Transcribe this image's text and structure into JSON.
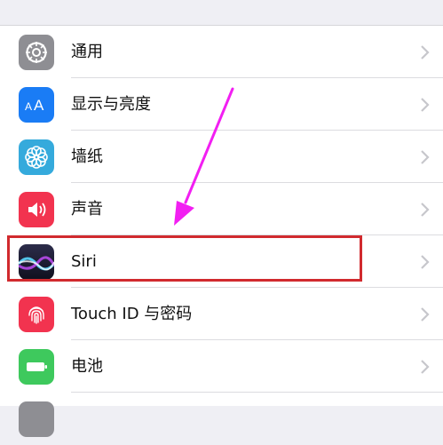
{
  "settings": {
    "items": [
      {
        "label": "通用",
        "icon": "gear-icon",
        "color": "#8e8e93"
      },
      {
        "label": "显示与亮度",
        "icon": "text-size-icon",
        "icon_text": "AA",
        "color": "#1a7cf5"
      },
      {
        "label": "墙纸",
        "icon": "flower-icon",
        "color": "#35aadc"
      },
      {
        "label": "声音",
        "icon": "speaker-icon",
        "color": "#f2334f"
      },
      {
        "label": "Siri",
        "icon": "siri-icon",
        "color": "#1c1c3a"
      },
      {
        "label": "Touch ID 与密码",
        "icon": "fingerprint-icon",
        "color": "#f2334f"
      },
      {
        "label": "电池",
        "icon": "battery-icon",
        "color": "#3ec95d"
      }
    ]
  },
  "annotation": {
    "highlight_color": "#d12a2e",
    "arrow_color": "#f21ff2",
    "highlighted_item": "Siri"
  }
}
